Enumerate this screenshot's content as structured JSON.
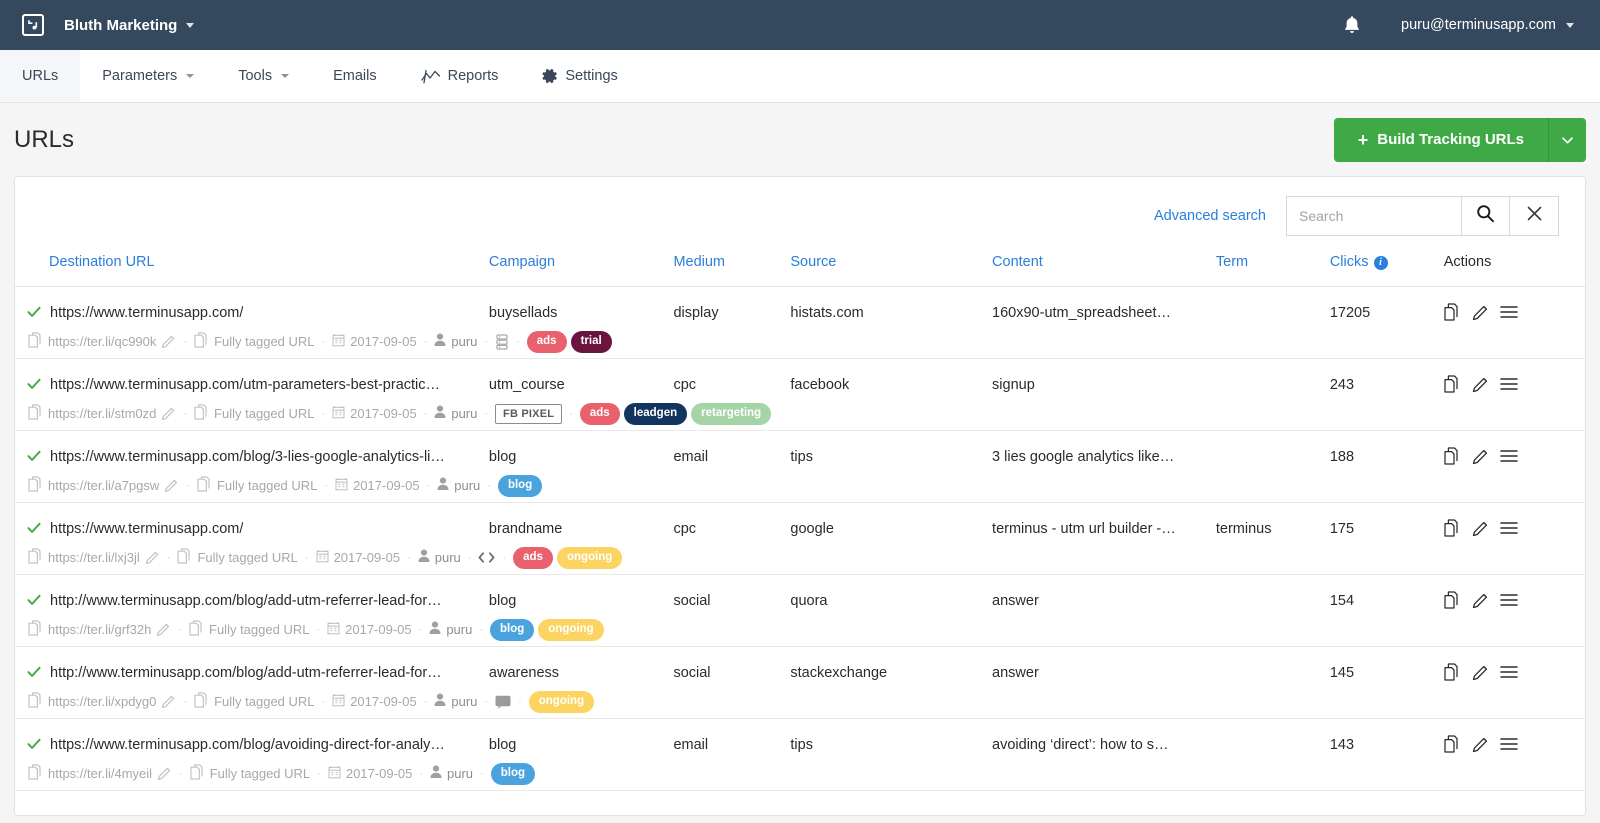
{
  "topbar": {
    "logo_icon": "terminus-logo-icon",
    "org_name": "Bluth Marketing",
    "bell_icon": "notification-bell-icon",
    "account_email": "puru@terminusapp.com"
  },
  "tabnav": {
    "tabs": [
      {
        "label": "URLs",
        "icon": null,
        "caret": false,
        "active": true
      },
      {
        "label": "Parameters",
        "icon": null,
        "caret": true,
        "active": false
      },
      {
        "label": "Tools",
        "icon": null,
        "caret": true,
        "active": false
      },
      {
        "label": "Emails",
        "icon": null,
        "caret": false,
        "active": false
      },
      {
        "label": "Reports",
        "icon": "line-chart-icon",
        "caret": false,
        "active": false
      },
      {
        "label": "Settings",
        "icon": "gear-icon",
        "caret": false,
        "active": false
      }
    ]
  },
  "page": {
    "title": "URLs",
    "build_button_label": "Build Tracking URLs",
    "build_button_plus": "+",
    "build_button_caret_icon": "chevron-down-icon",
    "build_button_color": "#3faa45"
  },
  "search": {
    "advanced_label": "Advanced search",
    "placeholder": "Search",
    "value": "",
    "search_icon": "magnifier-icon",
    "clear_icon": "close-x-icon"
  },
  "table": {
    "headers": {
      "destination": "Destination URL",
      "campaign": "Campaign",
      "medium": "Medium",
      "source": "Source",
      "content": "Content",
      "term": "Term",
      "clicks": "Clicks",
      "clicks_info_icon": "info-icon",
      "actions": "Actions"
    },
    "meta_labels": {
      "fully_tagged": "Fully tagged URL",
      "edit_icon": "pencil-edit-icon",
      "copy_icon": "copy-icon",
      "calendar_icon": "calendar-icon",
      "user_icon": "user-icon"
    },
    "action_icons": {
      "duplicate": "duplicate-icon",
      "edit": "pencil-edit-icon",
      "menu": "hamburger-menu-icon"
    },
    "tag_colors": {
      "ads": "#e8616d",
      "trial": "#6b1440",
      "leadgen": "#123560",
      "retargeting": "#a5d5a7",
      "blog": "#4ba3dd",
      "ongoing": "#fcd462"
    },
    "rows": [
      {
        "status_icon": "check-icon",
        "destination": "https://www.terminusapp.com/",
        "short_url": "https://ter.li/qc990k",
        "fully_tagged": "Fully tagged URL",
        "date": "2017-09-05",
        "user": "puru",
        "extra_icon": "server-stack-icon",
        "fb_pixel": null,
        "tags": [
          {
            "label": "ads",
            "color": "#e8616d"
          },
          {
            "label": "trial",
            "color": "#6b1440"
          }
        ],
        "campaign": "buysellads",
        "medium": "display",
        "source": "histats.com",
        "content": "160x90-utm_spreadsheet…",
        "term": "",
        "clicks": "17205"
      },
      {
        "status_icon": "check-icon",
        "destination": "https://www.terminusapp.com/utm-parameters-best-practic…",
        "short_url": "https://ter.li/stm0zd",
        "fully_tagged": "Fully tagged URL",
        "date": "2017-09-05",
        "user": "puru",
        "extra_icon": null,
        "fb_pixel": "FB PIXEL",
        "tags": [
          {
            "label": "ads",
            "color": "#e8616d"
          },
          {
            "label": "leadgen",
            "color": "#123560"
          },
          {
            "label": "retargeting",
            "color": "#a5d5a7"
          }
        ],
        "campaign": "utm_course",
        "medium": "cpc",
        "source": "facebook",
        "content": "signup",
        "term": "",
        "clicks": "243"
      },
      {
        "status_icon": "check-icon",
        "destination": "https://www.terminusapp.com/blog/3-lies-google-analytics-li…",
        "short_url": "https://ter.li/a7pgsw",
        "fully_tagged": "Fully tagged URL",
        "date": "2017-09-05",
        "user": "puru",
        "extra_icon": null,
        "fb_pixel": null,
        "tags": [
          {
            "label": "blog",
            "color": "#4ba3dd"
          }
        ],
        "campaign": "blog",
        "medium": "email",
        "source": "tips",
        "content": "3 lies google analytics like…",
        "term": "",
        "clicks": "188"
      },
      {
        "status_icon": "check-icon",
        "destination": "https://www.terminusapp.com/",
        "short_url": "https://ter.li/lxj3jl",
        "fully_tagged": "Fully tagged URL",
        "date": "2017-09-05",
        "user": "puru",
        "extra_icon": "code-brackets-icon",
        "fb_pixel": null,
        "tags": [
          {
            "label": "ads",
            "color": "#e8616d"
          },
          {
            "label": "ongoing",
            "color": "#fcd462"
          }
        ],
        "campaign": "brandname",
        "medium": "cpc",
        "source": "google",
        "content": "terminus - utm url builder -…",
        "term": "terminus",
        "clicks": "175"
      },
      {
        "status_icon": "check-icon",
        "destination": "http://www.terminusapp.com/blog/add-utm-referrer-lead-for…",
        "short_url": "https://ter.li/grf32h",
        "fully_tagged": "Fully tagged URL",
        "date": "2017-09-05",
        "user": "puru",
        "extra_icon": null,
        "fb_pixel": null,
        "tags": [
          {
            "label": "blog",
            "color": "#4ba3dd"
          },
          {
            "label": "ongoing",
            "color": "#fcd462"
          }
        ],
        "campaign": "blog",
        "medium": "social",
        "source": "quora",
        "content": "answer",
        "term": "",
        "clicks": "154"
      },
      {
        "status_icon": "check-icon",
        "destination": "http://www.terminusapp.com/blog/add-utm-referrer-lead-for…",
        "short_url": "https://ter.li/xpdyg0",
        "fully_tagged": "Fully tagged URL",
        "date": "2017-09-05",
        "user": "puru",
        "extra_icon": "comment-bubble-icon",
        "fb_pixel": null,
        "tags": [
          {
            "label": "ongoing",
            "color": "#fcd462"
          }
        ],
        "campaign": "awareness",
        "medium": "social",
        "source": "stackexchange",
        "content": "answer",
        "term": "",
        "clicks": "145"
      },
      {
        "status_icon": "check-icon",
        "destination": "https://www.terminusapp.com/blog/avoiding-direct-for-analy…",
        "short_url": "https://ter.li/4myeil",
        "fully_tagged": "Fully tagged URL",
        "date": "2017-09-05",
        "user": "puru",
        "extra_icon": null,
        "fb_pixel": null,
        "tags": [
          {
            "label": "blog",
            "color": "#4ba3dd"
          }
        ],
        "campaign": "blog",
        "medium": "email",
        "source": "tips",
        "content": "avoiding ‘direct’: how to s…",
        "term": "",
        "clicks": "143"
      }
    ]
  }
}
